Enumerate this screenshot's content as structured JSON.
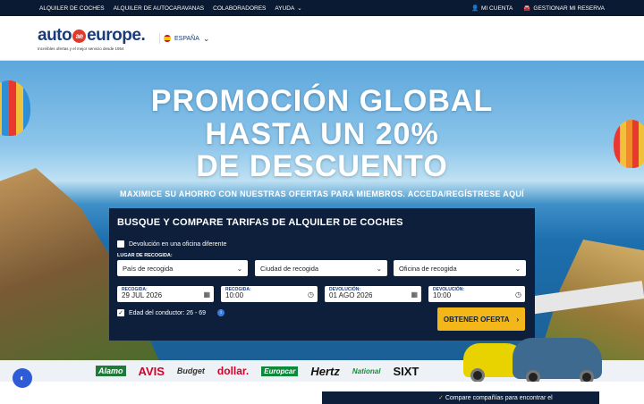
{
  "topbar": {
    "links": [
      "ALQUILER DE COCHES",
      "ALQUILER DE AUTOCARAVANAS",
      "COLABORADORES",
      "AYUDA"
    ],
    "account": "MI CUENTA",
    "reservation": "GESTIONAR MI RESERVA"
  },
  "header": {
    "logo_left": "auto",
    "logo_mark": "ae",
    "logo_right": "europe.",
    "tagline": "Increíbles ofertas y el mejor servicio desde 1954",
    "language": "ESPAÑA"
  },
  "hero": {
    "line1": "PROMOCIÓN GLOBAL",
    "line2": "HASTA UN 20%",
    "line3": "DE DESCUENTO",
    "subtitle": "MAXIMICE SU AHORRO CON NUESTRAS OFERTAS PARA MIEMBROS. ACCEDA/REGÍSTRESE AQUÍ"
  },
  "search": {
    "title": "BUSQUE Y COMPARE TARIFAS DE ALQUILER DE COCHES",
    "different_office": "Devolución en una oficina diferente",
    "pickup_place_label": "LUGAR DE RECOGIDA:",
    "country_placeholder": "País de recogida",
    "city_placeholder": "Ciudad de recogida",
    "office_placeholder": "Oficina de recogida",
    "pickup_date_label": "RECOGIDA:",
    "pickup_date": "29 JUL 2026",
    "pickup_time_label": "RECOGIDA:",
    "pickup_time": "10:00",
    "return_date_label": "DEVOLUCIÓN:",
    "return_date": "01 AGO 2026",
    "return_time_label": "DEVOLUCIÓN:",
    "return_time": "10:00",
    "driver_age": "Edad del conductor: 26 - 69",
    "cta": "OBTENER OFERTA"
  },
  "brands": [
    "Alamo",
    "AVIS",
    "Budget",
    "dollar.",
    "Europcar",
    "Hertz",
    "National",
    "SIXT"
  ],
  "bottom": {
    "compare_text": "Compare compañías para encontrar el"
  },
  "colors": {
    "navy": "#0d1f3a",
    "accent": "#f4b71a",
    "logo_blue": "#1a3b7a",
    "logo_red": "#e03a2f"
  }
}
